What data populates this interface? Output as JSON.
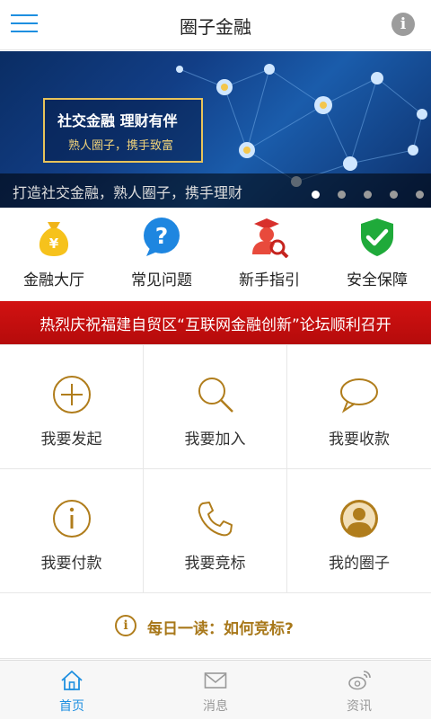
{
  "header": {
    "title": "圈子金融",
    "menu_icon": "hamburger-menu-icon",
    "info_icon": "info-icon",
    "info_glyph": "i",
    "accent_color": "#1e8fe0"
  },
  "banner": {
    "headline": "社交金融  理财有伴",
    "slogan": "熟人圈子，携手致富",
    "caption": "打造社交金融，熟人圈子，携手理财",
    "slides": 5,
    "active_slide": 1
  },
  "quick_links": [
    {
      "label": "金融大厅",
      "icon": "money-bag-icon"
    },
    {
      "label": "常见问题",
      "icon": "question-icon"
    },
    {
      "label": "新手指引",
      "icon": "user-search-icon"
    },
    {
      "label": "安全保障",
      "icon": "shield-check-icon"
    }
  ],
  "notice": {
    "text": "热烈庆祝福建自贸区“互联网金融创新”论坛顺利召开",
    "color": "#c50f0f"
  },
  "actions": [
    {
      "label": "我要发起",
      "icon": "plus-circle-icon"
    },
    {
      "label": "我要加入",
      "icon": "search-icon"
    },
    {
      "label": "我要收款",
      "icon": "chat-bubble-icon"
    },
    {
      "label": "我要付款",
      "icon": "info-circle-icon"
    },
    {
      "label": "我要竞标",
      "icon": "phone-icon"
    },
    {
      "label": "我的圈子",
      "icon": "user-circle-icon"
    }
  ],
  "daily": {
    "glyph": "i",
    "text": "每日一读：如何竞标?",
    "color": "#a8781a"
  },
  "tabs": [
    {
      "label": "首页",
      "icon": "home-icon",
      "active": true
    },
    {
      "label": "消息",
      "icon": "mail-icon",
      "active": false
    },
    {
      "label": "资讯",
      "icon": "weibo-icon",
      "active": false
    }
  ]
}
